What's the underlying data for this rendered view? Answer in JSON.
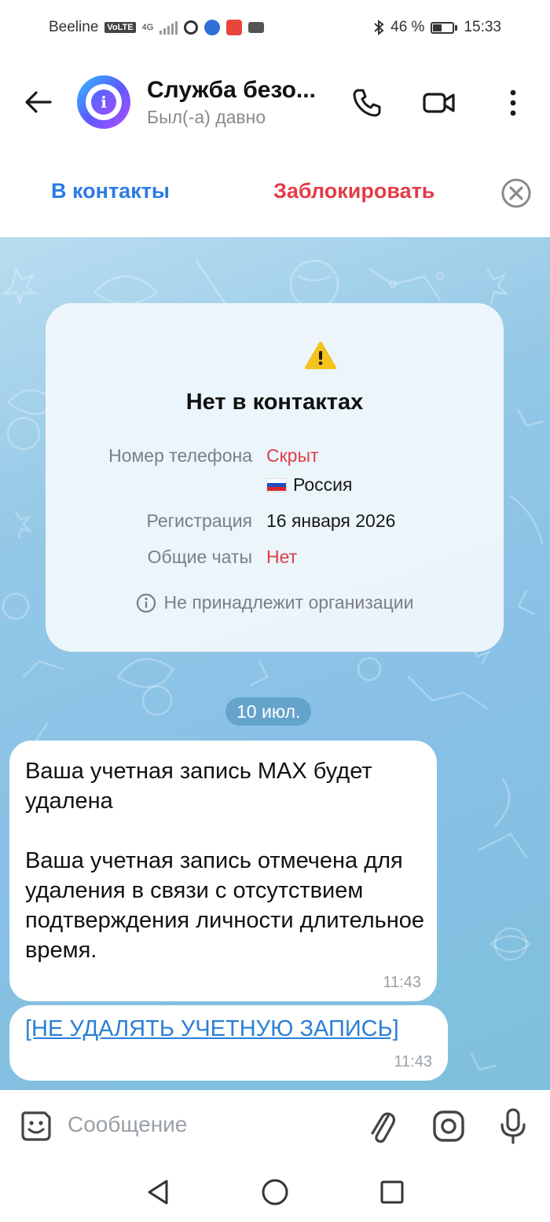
{
  "status_bar": {
    "carrier": "Beeline",
    "volte": "VoLTE",
    "network": "4G",
    "battery": "46 %",
    "time": "15:33"
  },
  "header": {
    "title": "Служба безо...",
    "subtitle": "Был(-а) давно",
    "icons": [
      "back-arrow-icon",
      "phone-icon",
      "video-camera-icon",
      "more-vertical-icon"
    ]
  },
  "actions": {
    "add_contact": "В контакты",
    "block": "Заблокировать"
  },
  "info_card": {
    "title": "Нет в контактах",
    "phone_label": "Номер телефона",
    "phone_value": "Скрыт",
    "country": "Россия",
    "registration_label": "Регистрация",
    "registration_value": "16 января 2026",
    "common_chats_label": "Общие чаты",
    "common_chats_value": "Нет",
    "org_note": "Не принадлежит организации"
  },
  "date_separator": "10 июл.",
  "messages": [
    {
      "text": "Ваша учетная запись МАХ будет удалена\n\nВаша учетная запись отмечена для удаления в связи с отсутствием подтверждения личности длительное время.",
      "time": "11:43"
    },
    {
      "text": "[НЕ УДАЛЯТЬ УЧЕТНУЮ ЗАПИСЬ]",
      "time": "11:43"
    }
  ],
  "composer": {
    "placeholder": "Сообщение"
  },
  "colors": {
    "accent_blue": "#2a7be4",
    "danger_red": "#e23c48",
    "link_blue": "#2b7fd6"
  }
}
